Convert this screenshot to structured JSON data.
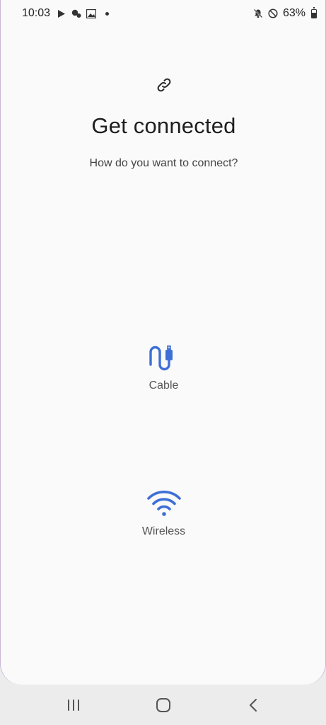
{
  "status_bar": {
    "time": "10:03",
    "battery": "63%",
    "battery_level": 0.63,
    "left_icons": [
      "play-store-icon",
      "notification-bubbles-icon",
      "gallery-icon",
      "dot-icon"
    ],
    "right_icons": [
      "mute-icon",
      "do-not-disturb-icon",
      "battery-icon"
    ]
  },
  "header": {
    "icon": "link-icon",
    "title": "Get connected",
    "subtitle": "How do you want to connect?"
  },
  "options": [
    {
      "label": "Cable",
      "icon": "usb-cable-icon"
    },
    {
      "label": "Wireless",
      "icon": "wifi-icon"
    }
  ],
  "nav_bar": {
    "buttons": [
      "recent-apps-icon",
      "home-icon",
      "back-icon"
    ]
  },
  "colors": {
    "accent": "#3d6fd6",
    "background": "#fafafa",
    "nav_background": "#ececec"
  }
}
